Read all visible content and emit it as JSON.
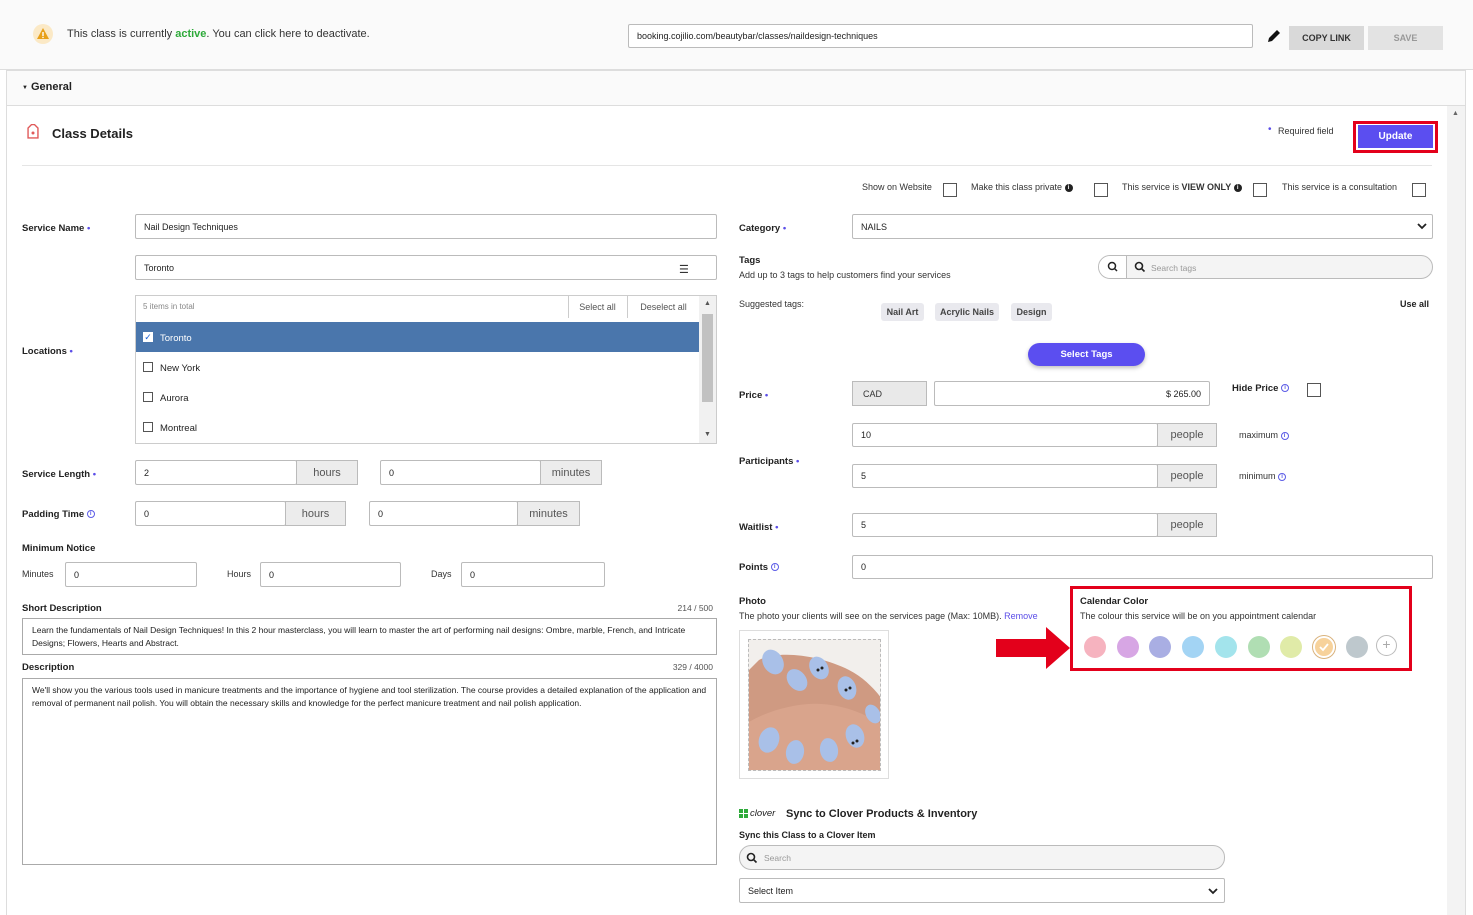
{
  "status_bar": {
    "pre": "This class is currently ",
    "active": "active",
    "post": ". You can click here to deactivate.",
    "link": "booking.cojilio.com/beautybar/classes/naildesign-techniques",
    "copy_link": "COPY LINK",
    "save": "SAVE"
  },
  "general": "General",
  "header": {
    "title": "Class Details",
    "required_note": "Required field",
    "update": "Update"
  },
  "flags": {
    "show_on_website": "Show on Website",
    "make_private": "Make this class private",
    "view_only_pre": "This service is ",
    "view_only_bold": "VIEW ONLY",
    "consultation": "This service is a consultation"
  },
  "left": {
    "service_name_label": "Service Name",
    "service_name_value": "Nail Design Techniques",
    "location_select": "Toronto",
    "locations_label": "Locations",
    "locations_count": "5 items in total",
    "select_all": "Select all",
    "deselect_all": "Deselect all",
    "location_items": [
      {
        "name": "Toronto",
        "checked": true
      },
      {
        "name": "New York",
        "checked": false
      },
      {
        "name": "Aurora",
        "checked": false
      },
      {
        "name": "Montreal",
        "checked": false
      }
    ],
    "service_length_label": "Service Length",
    "length_hours": "2",
    "length_minutes": "0",
    "hours": "hours",
    "minutes": "minutes",
    "padding_label": "Padding Time",
    "padding_hours": "0",
    "padding_minutes": "0",
    "min_notice_label": "Minimum Notice",
    "mn_minutes_label": "Minutes",
    "mn_minutes": "0",
    "mn_hours_label": "Hours",
    "mn_hours": "0",
    "mn_days_label": "Days",
    "mn_days": "0",
    "short_desc_label": "Short Description",
    "short_desc_count": "214 / 500",
    "short_desc": "Learn the fundamentals of Nail Design Techniques! In this 2 hour masterclass, you will learn to master the art of performing nail designs: Ombre, marble, French, and Intricate Designs; Flowers, Hearts and Abstract.",
    "desc_label": "Description",
    "desc_count": "329 / 4000",
    "desc": "We'll show you the various tools used in manicure treatments and the importance of hygiene and tool sterilization. The course provides a detailed explanation of the application and removal of permanent nail polish. You will obtain the necessary skills and knowledge for the perfect manicure treatment and nail polish application."
  },
  "right": {
    "category_label": "Category",
    "category_value": "NAILS",
    "tags_label": "Tags",
    "tags_sub": "Add up to 3 tags to help customers find your services",
    "search_tags": "Search tags",
    "suggested_label": "Suggested tags:",
    "suggested": [
      "Nail Art",
      "Acrylic Nails",
      "Design"
    ],
    "use_all": "Use all",
    "select_tags": "Select Tags",
    "price_label": "Price",
    "currency": "CAD",
    "price": "$ 265.00",
    "hide_price": "Hide Price",
    "participants_label": "Participants",
    "max_value": "10",
    "min_value": "5",
    "people": "people",
    "maximum": "maximum",
    "minimum": "minimum",
    "waitlist_label": "Waitlist",
    "waitlist_value": "5",
    "points_label": "Points",
    "points_value": "0",
    "photo_label": "Photo",
    "photo_sub": "The photo your clients will see on the services page (Max: 10MB).",
    "remove": "Remove",
    "calendar_label": "Calendar Color",
    "calendar_sub": "The colour this service will be on you appointment calendar",
    "colors": [
      "#f6b3bf",
      "#d7a6e4",
      "#a9aee3",
      "#a3d4f4",
      "#a3e4ec",
      "#b0deb3",
      "#e0eba8",
      "#f7d29b",
      "#bec8cd"
    ],
    "clover_brand": "clover",
    "clover_title": "Sync to Clover Products & Inventory",
    "clover_sub": "Sync this Class to a Clover Item",
    "clover_search": "Search",
    "clover_select": "Select Item"
  }
}
